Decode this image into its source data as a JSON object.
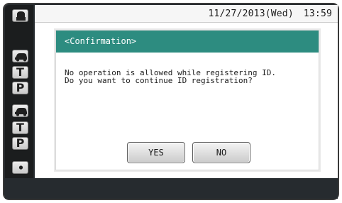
{
  "status": {
    "date": "11/27/2013(Wed)",
    "time": "13:59"
  },
  "sidebar": {
    "items": [
      {
        "kind": "icon",
        "icon": "lock-icon"
      },
      {
        "kind": "icon",
        "icon": "car-icon"
      },
      {
        "kind": "text",
        "label": "T"
      },
      {
        "kind": "text",
        "label": "P"
      },
      {
        "kind": "icon",
        "icon": "car-icon"
      },
      {
        "kind": "text",
        "label": "T"
      },
      {
        "kind": "text",
        "label": "P"
      },
      {
        "kind": "icon",
        "icon": "dot-icon"
      }
    ]
  },
  "dialog": {
    "title": "<Confirmation>",
    "lines": [
      "No operation is allowed while registering ID.",
      "Do you want to continue ID registration?"
    ],
    "yes_label": "YES",
    "no_label": "NO"
  },
  "colors": {
    "header": "#2d8c80",
    "bezel": "#3a3a3a",
    "screen": "#262b2f",
    "sidebar": "#1b1d1e"
  }
}
